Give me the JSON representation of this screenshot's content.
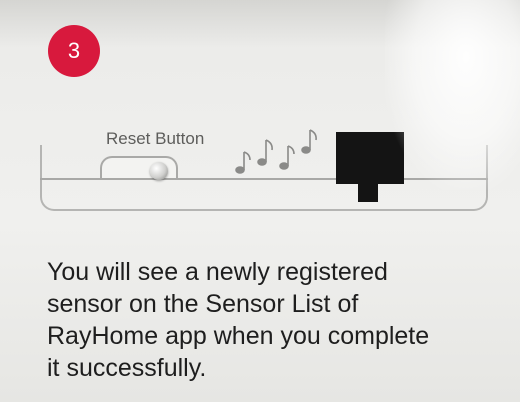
{
  "step": {
    "number": "3",
    "badge_color": "#d8193d"
  },
  "illustration": {
    "reset_label": "Reset Button",
    "icons": [
      "reset-switch-icon",
      "music-notes-icon",
      "sensor-device-icon"
    ]
  },
  "instruction": {
    "lines": [
      "You will see a newly registered",
      "sensor on the Sensor List of",
      "RayHome app when you complete",
      "it successfully."
    ]
  }
}
